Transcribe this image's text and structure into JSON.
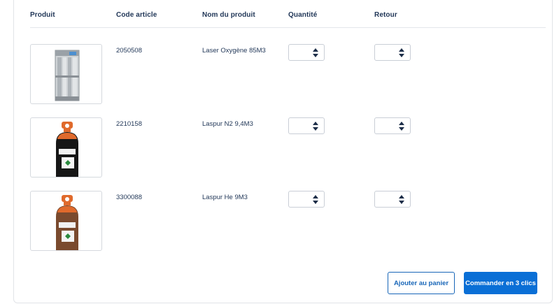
{
  "table": {
    "headers": {
      "produit": "Produit",
      "code": "Code article",
      "nom": "Nom du produit",
      "quantite": "Quantité",
      "retour": "Retour"
    },
    "rows": [
      {
        "image": "gas-bundle-rack",
        "code": "2050508",
        "name": "Laser Oxygène 85M3",
        "quantite": "",
        "retour": ""
      },
      {
        "image": "gas-cylinder-black-orange",
        "code": "2210158",
        "name": "Laspur N2 9,4M3",
        "quantite": "",
        "retour": ""
      },
      {
        "image": "gas-cylinder-brown-orange",
        "code": "3300088",
        "name": "Laspur He 9M3",
        "quantite": "",
        "retour": ""
      }
    ]
  },
  "actions": {
    "add_to_cart": "Ajouter au panier",
    "order_3_clicks": "Commander en 3 clics"
  },
  "colors": {
    "primary": "#0a6fd6",
    "outline": "#1866b8",
    "text": "#1f3556",
    "border": "#d5d9de"
  }
}
